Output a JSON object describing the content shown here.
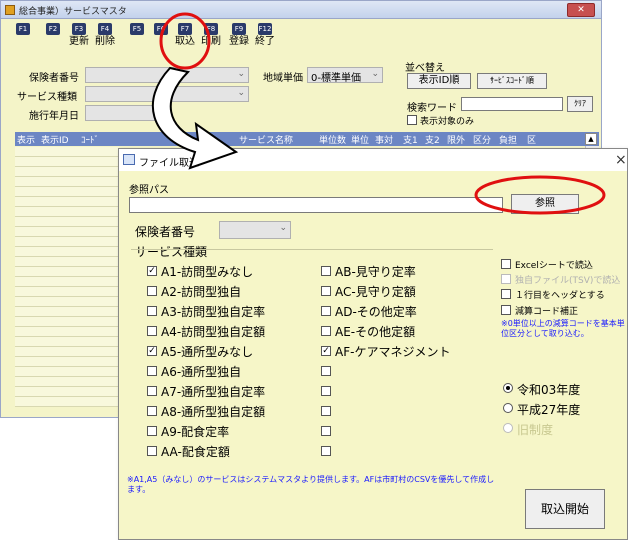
{
  "main_window": {
    "title": "総合事業）サービスマスタ",
    "close_label": "✕",
    "toolbar": [
      {
        "key": "F1",
        "label": ""
      },
      {
        "key": "F2",
        "label": ""
      },
      {
        "key": "F3",
        "label": "更新"
      },
      {
        "key": "F4",
        "label": "削除"
      },
      {
        "key": "F5",
        "label": ""
      },
      {
        "key": "F6",
        "label": ""
      },
      {
        "key": "F7",
        "label": "取込"
      },
      {
        "key": "F8",
        "label": "印刷"
      },
      {
        "key": "F9",
        "label": "登録"
      },
      {
        "key": "F12",
        "label": "終了"
      }
    ],
    "insurer_label": "保険者番号",
    "service_type_label": "サービス種類",
    "effective_date_label": "施行年月日",
    "area_unit_label": "地域単価",
    "area_unit_value": "0-標準単価",
    "sort_label": "並べ替え",
    "sort_by_id_label": "表示ID順",
    "sort_by_code_label": "ｻｰﾋﾞｽｺｰﾄﾞ順",
    "search_word_label": "検索ワード",
    "clear_label": "ｸﾘｱ",
    "display_only_label": "表示対象のみ",
    "grid_headers": [
      "表示",
      "表示ID",
      "ｺｰﾄﾞ",
      "サービス名称",
      "単位数",
      "単位",
      "事対",
      "支1",
      "支2",
      "限外",
      "区分",
      "負担",
      "区"
    ]
  },
  "dialog": {
    "title": "ファイル取込",
    "close_label": "×",
    "ref_path_label": "参照パス",
    "ref_path_value": "",
    "browse_label": "参照",
    "insurer_label": "保険者番号",
    "service_type_label": "サービス種類",
    "services_left": [
      {
        "label": "A1-訪問型みなし",
        "checked": true
      },
      {
        "label": "A2-訪問型独自",
        "checked": false
      },
      {
        "label": "A3-訪問型独自定率",
        "checked": false
      },
      {
        "label": "A4-訪問型独自定額",
        "checked": false
      },
      {
        "label": "A5-通所型みなし",
        "checked": true
      },
      {
        "label": "A6-通所型独自",
        "checked": false
      },
      {
        "label": "A7-通所型独自定率",
        "checked": false
      },
      {
        "label": "A8-通所型独自定額",
        "checked": false
      },
      {
        "label": "A9-配食定率",
        "checked": false
      },
      {
        "label": "AA-配食定額",
        "checked": false
      }
    ],
    "services_right": [
      {
        "label": "AB-見守り定率",
        "checked": false
      },
      {
        "label": "AC-見守り定額",
        "checked": false
      },
      {
        "label": "AD-その他定率",
        "checked": false
      },
      {
        "label": "AE-その他定額",
        "checked": false
      },
      {
        "label": "AF-ケアマネジメント",
        "checked": true
      },
      {
        "label": "",
        "checked": false
      },
      {
        "label": "",
        "checked": false
      },
      {
        "label": "",
        "checked": false
      },
      {
        "label": "",
        "checked": false
      },
      {
        "label": "",
        "checked": false
      }
    ],
    "excel_sheet_label": "Excelシートで読込",
    "own_file_label": "独自ファイル(TSV)で読込",
    "header_row_label": "１行目をヘッダとする",
    "reduction_code_label": "減算コード補正",
    "reduction_note": "※0単位以上の減算コードを基本単位区分として取り込む。",
    "years": [
      {
        "label": "令和03年度",
        "selected": true,
        "enabled": true
      },
      {
        "label": "平成27年度",
        "selected": false,
        "enabled": true
      },
      {
        "label": "旧制度",
        "selected": false,
        "enabled": false
      }
    ],
    "footnote": "※A1,A5（みなし）のサービスはシステムマスタより提供します。AFは市町村のCSVを優先して作成します。",
    "start_label": "取込開始"
  },
  "colors": {
    "annotation_red": "#e01010",
    "dialog_bg": "#f6f6c8",
    "grid_header": "#6c86c4",
    "note_blue": "#1a1aff"
  }
}
